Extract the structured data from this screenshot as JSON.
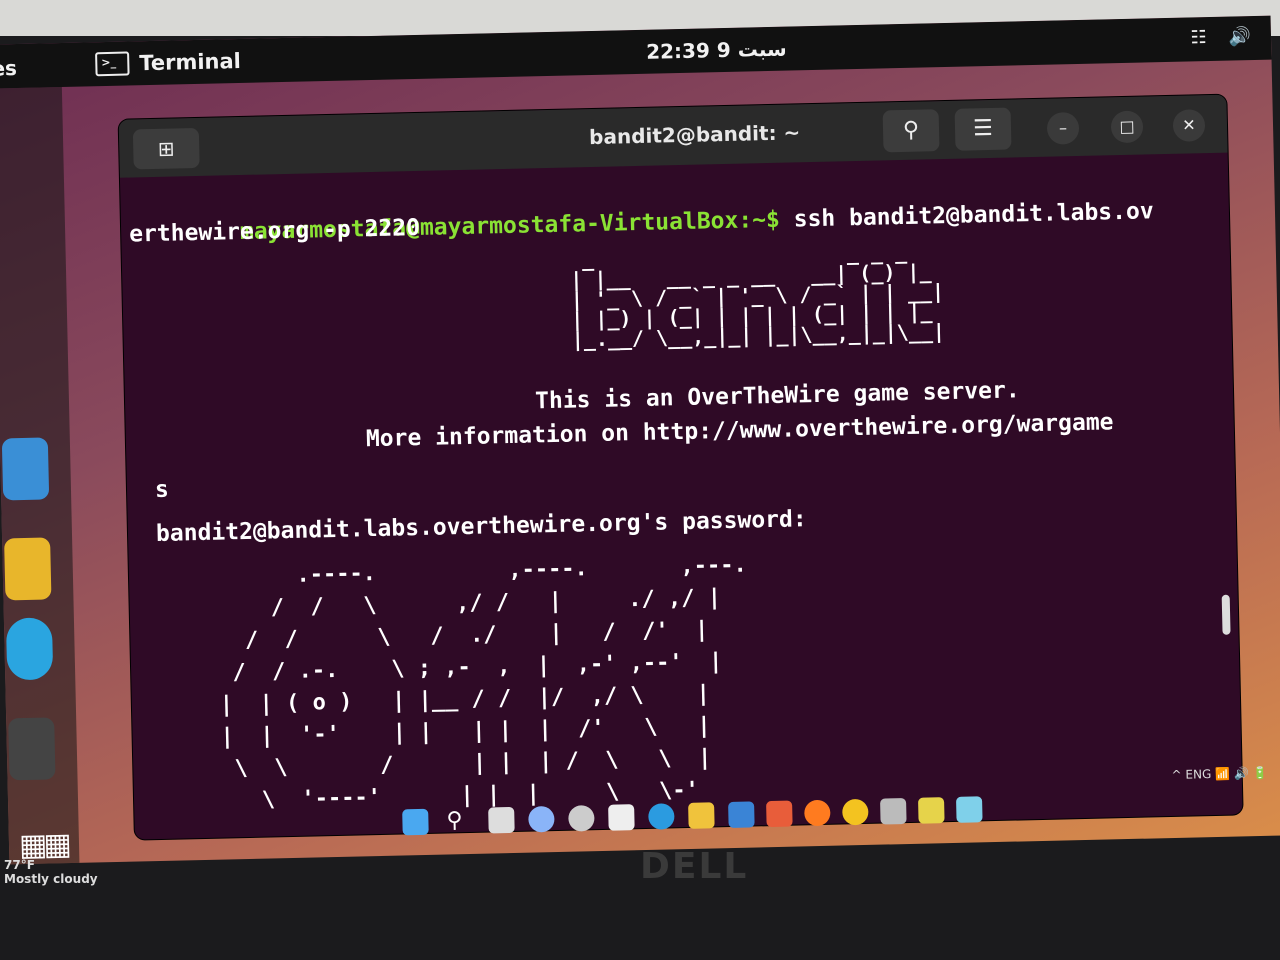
{
  "topbar": {
    "activities": "es",
    "app_name": "Terminal",
    "clock": "22:39 9 سبت"
  },
  "window": {
    "title": "bandit2@bandit: ~",
    "new_tab_icon": "new-tab-icon",
    "search_icon": "search-icon",
    "menu_icon": "hamburger-icon",
    "minimize_icon": "minimize-icon",
    "maximize_icon": "maximize-icon",
    "close_icon": "close-icon"
  },
  "terminal": {
    "prompt": "mayarmostafa@mayarmostafa-VirtualBox:~$",
    "command": " ssh bandit2@bandit.labs.ov",
    "command_wrap": "erthewire.org -p 2220",
    "banner_line1": "This is an OverTheWire game server.",
    "banner_line2": "More information on http://www.overthewire.org/wargame",
    "banner_wrap": "s",
    "password_prompt": "bandit2@bandit.labs.overthewire.org's password:",
    "ascii_logo": " _                     _ _ _   \n| |__   __ _ _ __   __| (_) |_ \n| '_ \\ / _` | '_ \\ / _` | | __|\n| |_) | (_| | | | | (_| | | |_ \n|_.__/ \\__,_|_| |_|\\__,_|_|\\__|",
    "ascii_art": "      .----.          ,----.       ,---.\n    /  /   \\      ,/ /   |     ./ ,/ |\n  /  /      \\   /  ./    |   /  /'  |\n /  / .-.    \\ ; ,-  ,  |  ,-' ,--'  |\n|  | ( o )   | |__ / /  |/  ,/ \\    |\n|  |  '-'    | |   | |  |  /'   \\   |\n \\  \\       /      | |  | /  \\   \\  |\n   \\  '----'      | |  |     \\   \\-'"
  },
  "taskbar": {
    "weather_temp": "77°F",
    "weather_text": "Mostly cloudy",
    "brand": "DELL"
  }
}
